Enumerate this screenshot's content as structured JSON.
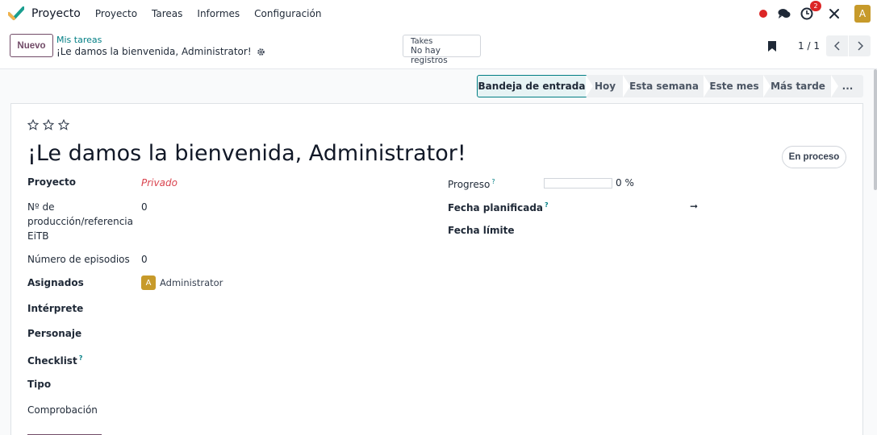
{
  "navbar": {
    "app_name": "Proyecto",
    "menu": [
      "Proyecto",
      "Tareas",
      "Informes",
      "Configuración"
    ],
    "activity_count": "2",
    "user_initial": "A"
  },
  "control": {
    "new_label": "Nuevo",
    "breadcrumb_parent": "Mis tareas",
    "breadcrumb_current": "¡Le damos la bienvenida, Administrator!",
    "takes_title": "Takes",
    "takes_value": "No hay registros",
    "pager_value": "1 / 1"
  },
  "stages": [
    "Bandeja de entrada",
    "Hoy",
    "Esta semana",
    "Este mes",
    "Más tarde",
    "..."
  ],
  "form": {
    "priority_stars": 3,
    "title": "¡Le damos la bienvenida, Administrator!",
    "state_label": "En proceso",
    "left_fields": [
      {
        "label": "Proyecto",
        "value": "Privado"
      },
      {
        "label": "Nº de producción/referencia EiTB",
        "value": "0"
      },
      {
        "label": "Número de episodios",
        "value": "0"
      },
      {
        "label": "Asignados",
        "value": "Administrator",
        "initial": "A"
      },
      {
        "label": "Intérprete",
        "value": ""
      },
      {
        "label": "Personaje",
        "value": ""
      },
      {
        "label": "Checklist",
        "value": ""
      },
      {
        "label": "Tipo",
        "value": ""
      },
      {
        "label": "Comprobación",
        "value": ""
      }
    ],
    "right_fields": [
      {
        "label": "Progreso",
        "value": "0 %",
        "progress": 0
      },
      {
        "label": "Fecha planificada",
        "value": "➞"
      },
      {
        "label": "Fecha límite",
        "value": ""
      }
    ],
    "help_mark": "?"
  },
  "colors": {
    "brand": "#714b67",
    "accent": "#017e84",
    "danger": "#dc2626"
  }
}
